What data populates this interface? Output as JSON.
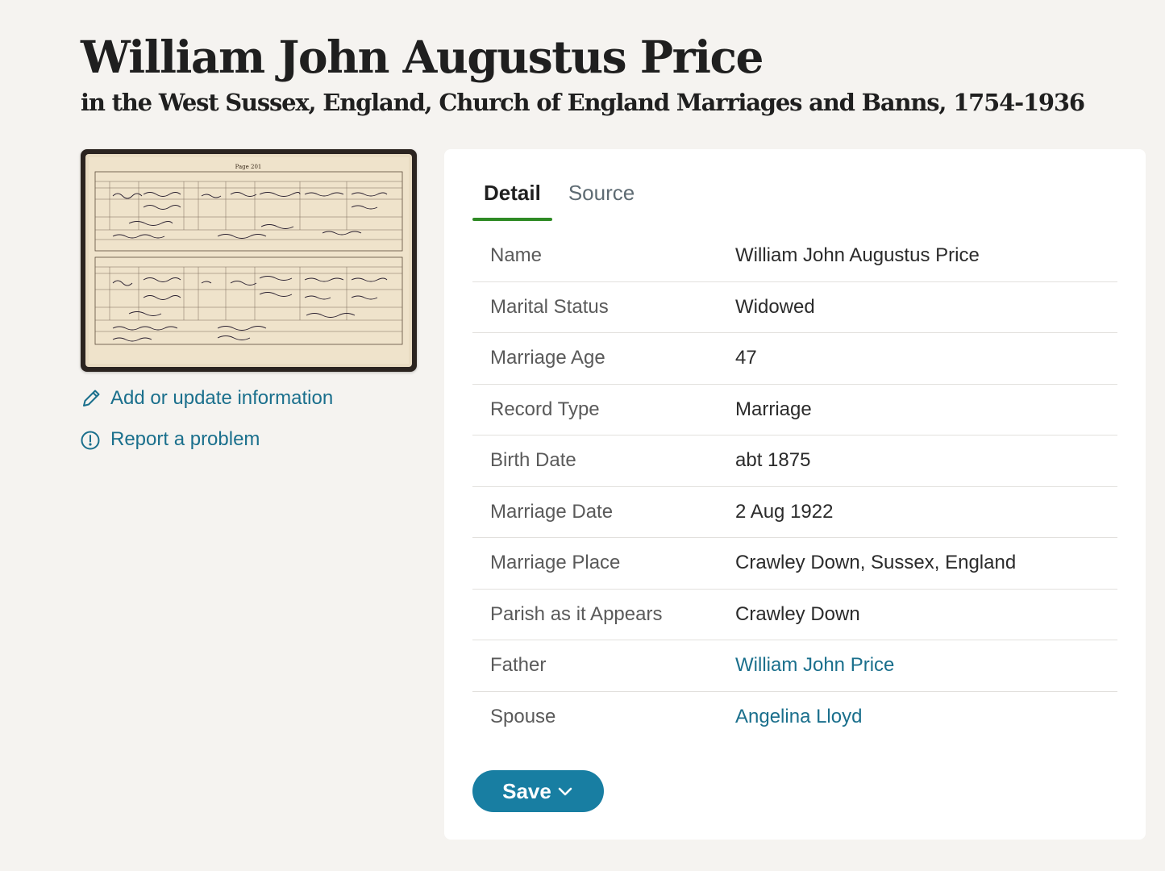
{
  "header": {
    "title": "William John Augustus Price",
    "subtitle": "in the West Sussex, England, Church of England Marriages and Banns, 1754-1936"
  },
  "record_image": {
    "page_label": "Page 201"
  },
  "side_links": {
    "add_update": "Add or update information",
    "report": "Report a problem"
  },
  "tabs": [
    {
      "label": "Detail",
      "active": true
    },
    {
      "label": "Source",
      "active": false
    }
  ],
  "details": [
    {
      "label": "Name",
      "value": "William John Augustus Price"
    },
    {
      "label": "Marital Status",
      "value": "Widowed"
    },
    {
      "label": "Marriage Age",
      "value": "47"
    },
    {
      "label": "Record Type",
      "value": "Marriage"
    },
    {
      "label": "Birth Date",
      "value": "abt 1875"
    },
    {
      "label": "Marriage Date",
      "value": "2 Aug 1922"
    },
    {
      "label": "Marriage Place",
      "value": "Crawley Down, Sussex, England"
    },
    {
      "label": "Parish as it Appears",
      "value": "Crawley Down"
    },
    {
      "label": "Father",
      "value": "William John Price",
      "link": true
    },
    {
      "label": "Spouse",
      "value": "Angelina Lloyd",
      "link": true
    }
  ],
  "save_button": {
    "label": "Save"
  },
  "colors": {
    "link": "#1a6f8c",
    "accent_tab": "#2f8a25",
    "button": "#187ea2",
    "background": "#f5f3f0"
  },
  "icons": [
    "pencil-icon",
    "alert-circle-icon",
    "chevron-down-icon"
  ]
}
